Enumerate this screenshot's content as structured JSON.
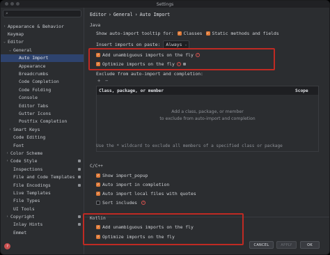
{
  "window": {
    "title": "Settings"
  },
  "search": {
    "icon": "search-icon",
    "glyph": "⌕"
  },
  "sidebar": {
    "items": [
      {
        "label": "Appearance & Behavior",
        "indent": 0,
        "chevron": "›",
        "mark": false,
        "selected": false
      },
      {
        "label": "Keymap",
        "indent": 0,
        "chevron": "",
        "mark": false,
        "selected": false
      },
      {
        "label": "Editor",
        "indent": 0,
        "chevron": "⌄",
        "mark": false,
        "selected": false
      },
      {
        "label": "General",
        "indent": 1,
        "chevron": "⌄",
        "mark": false,
        "selected": false
      },
      {
        "label": "Auto Import",
        "indent": 2,
        "chevron": "",
        "mark": false,
        "selected": true
      },
      {
        "label": "Appearance",
        "indent": 2,
        "chevron": "",
        "mark": false,
        "selected": false
      },
      {
        "label": "Breadcrumbs",
        "indent": 2,
        "chevron": "",
        "mark": false,
        "selected": false
      },
      {
        "label": "Code Completion",
        "indent": 2,
        "chevron": "",
        "mark": false,
        "selected": false
      },
      {
        "label": "Code Folding",
        "indent": 2,
        "chevron": "",
        "mark": false,
        "selected": false
      },
      {
        "label": "Console",
        "indent": 2,
        "chevron": "",
        "mark": false,
        "selected": false
      },
      {
        "label": "Editor Tabs",
        "indent": 2,
        "chevron": "",
        "mark": false,
        "selected": false
      },
      {
        "label": "Gutter Icons",
        "indent": 2,
        "chevron": "",
        "mark": false,
        "selected": false
      },
      {
        "label": "Postfix Completion",
        "indent": 2,
        "chevron": "",
        "mark": false,
        "selected": false
      },
      {
        "label": "Smart Keys",
        "indent": 1,
        "chevron": "›",
        "mark": false,
        "selected": false
      },
      {
        "label": "Code Editing",
        "indent": 1,
        "chevron": "",
        "mark": false,
        "selected": false
      },
      {
        "label": "Font",
        "indent": 1,
        "chevron": "",
        "mark": false,
        "selected": false
      },
      {
        "label": "Color Scheme",
        "indent": 0.5,
        "chevron": "›",
        "mark": false,
        "selected": false
      },
      {
        "label": "Code Style",
        "indent": 0.5,
        "chevron": "›",
        "mark": true,
        "selected": false
      },
      {
        "label": "Inspections",
        "indent": 1,
        "chevron": "",
        "mark": true,
        "selected": false
      },
      {
        "label": "File and Code Templates",
        "indent": 1,
        "chevron": "",
        "mark": true,
        "selected": false
      },
      {
        "label": "File Encodings",
        "indent": 1,
        "chevron": "",
        "mark": true,
        "selected": false
      },
      {
        "label": "Live Templates",
        "indent": 1,
        "chevron": "",
        "mark": false,
        "selected": false
      },
      {
        "label": "File Types",
        "indent": 1,
        "chevron": "",
        "mark": false,
        "selected": false
      },
      {
        "label": "UI Tools",
        "indent": 1,
        "chevron": "",
        "mark": false,
        "selected": false
      },
      {
        "label": "Copyright",
        "indent": 0.5,
        "chevron": "›",
        "mark": true,
        "selected": false
      },
      {
        "label": "Inlay Hints",
        "indent": 1,
        "chevron": "",
        "mark": true,
        "selected": false
      },
      {
        "label": "Emmet",
        "indent": 1,
        "chevron": "",
        "mark": false,
        "selected": false
      }
    ],
    "help_icon": "?"
  },
  "main": {
    "breadcrumb": [
      "Editor",
      "›",
      "General",
      "›",
      "Auto Import"
    ],
    "java": {
      "title": "Java",
      "tooltip_label": "Show auto-import tooltip for:",
      "classes_label": "Classes",
      "static_label": "Static methods and fields",
      "insert_label": "Insert imports on paste:",
      "insert_value": "Always",
      "add_unambiguous_label": "Add unambiguous imports on the fly",
      "optimize_label": "Optimize imports on the fly",
      "exclude_label": "Exclude from auto-import and completion:",
      "add_tool": "+",
      "remove_tool": "−",
      "col_pkg": "Class, package, or member",
      "col_scope": "Scope",
      "empty_line1": "Add a class, package, or member",
      "empty_line2": "to exclude from auto-import and completion",
      "wildcard_note": "Use the * wildcard to exclude all members of a specified class or package"
    },
    "cpp": {
      "title": "C/C++",
      "show_import_popup": "Show import_popup",
      "auto_import_completion": "Auto import in completion",
      "auto_import_quotes": "Auto import local files with quotes",
      "sort_includes": "Sort includes"
    },
    "kotlin": {
      "title": "Kotlin",
      "add_unambiguous_label": "Add unambiguous imports on the fly",
      "optimize_label": "Optimize imports on the fly"
    }
  },
  "buttons": {
    "cancel": "CANCEL",
    "apply": "APPLY",
    "ok": "OK"
  },
  "colors": {
    "accent_checkbox": "#e07b39",
    "highlight": "#c02a23",
    "selection": "#2e436e"
  }
}
